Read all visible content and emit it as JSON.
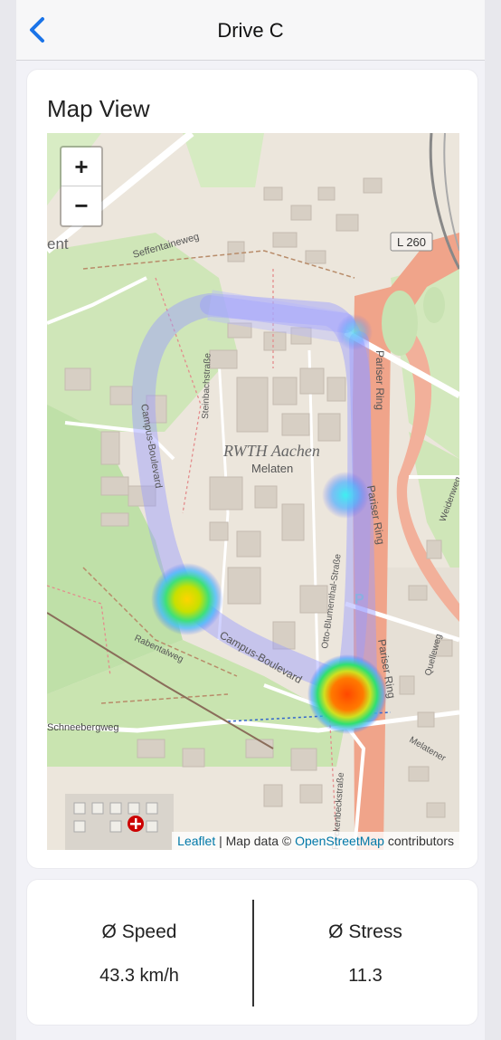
{
  "header": {
    "title": "Drive C",
    "back_icon": "chevron-left-icon",
    "accent": "#1a73e8"
  },
  "map_card": {
    "title": "Map View",
    "zoom_in": "+",
    "zoom_out": "−",
    "attribution": {
      "leaflet": "Leaflet",
      "separator": " | Map data © ",
      "osm": "OpenStreetMap",
      "suffix": " contributors"
    },
    "labels": {
      "campus": "RWTH Aachen",
      "district": "Melaten",
      "road_badge": "L 260",
      "street_campus_boulevard": "Campus-Boulevard",
      "street_campus_boulevard_2": "Campus-Boulevard",
      "street_pariser_ring": "Pariser Ring",
      "street_pariser_ring_2": "Pariser Ring",
      "street_pariser_ring_3": "Pariser Ring",
      "street_steinbach": "Steinbachstraße",
      "street_blumenthal": "Otto-Blumenthal-Straße",
      "street_seffent": "Seffentaineweg",
      "street_schneeberg": "Schneebergweg",
      "street_rabental": "Rabentalweg",
      "street_forckenbeck": "Forckenbeckstraße",
      "street_melatener": "Melatener",
      "street_weidenweg": "Weidenweg",
      "street_quelleweg": "Quelleweg",
      "partial_ent": "ent",
      "parking": "P"
    },
    "heatmap_spots": [
      {
        "name": "hotspot-yellow",
        "intensity": "medium"
      },
      {
        "name": "hotspot-red",
        "intensity": "high"
      },
      {
        "name": "hotspot-cyan",
        "intensity": "low"
      }
    ]
  },
  "stats": {
    "speed_label": "Ø Speed",
    "speed_value": "43.3 km/h",
    "stress_label": "Ø Stress",
    "stress_value": "11.3"
  }
}
